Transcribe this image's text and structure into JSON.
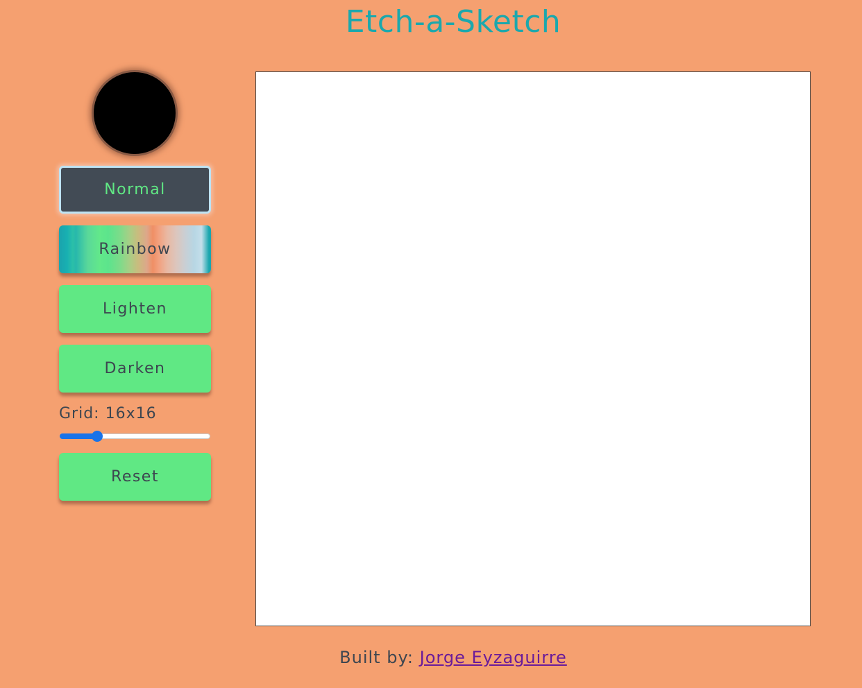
{
  "header": {
    "title": "Etch-a-Sketch"
  },
  "controls": {
    "current_color": "#000000",
    "buttons": {
      "normal": "Normal",
      "rainbow": "Rainbow",
      "lighten": "Lighten",
      "darken": "Darken",
      "reset": "Reset"
    },
    "active_mode": "Normal",
    "grid_label": "Grid: 16x16",
    "grid_size": 16,
    "grid_slider_fraction": 0.25
  },
  "footer": {
    "prefix": "Built by: ",
    "author_link": "Jorge Eyzaguirre"
  },
  "colors": {
    "background": "#F5A070",
    "title": "#1BA8AD",
    "button_green": "#60E884",
    "button_active": "#424B55",
    "text_dark": "#3d4650",
    "link": "#6A1B9A",
    "slider_accent": "#1A73E8"
  }
}
